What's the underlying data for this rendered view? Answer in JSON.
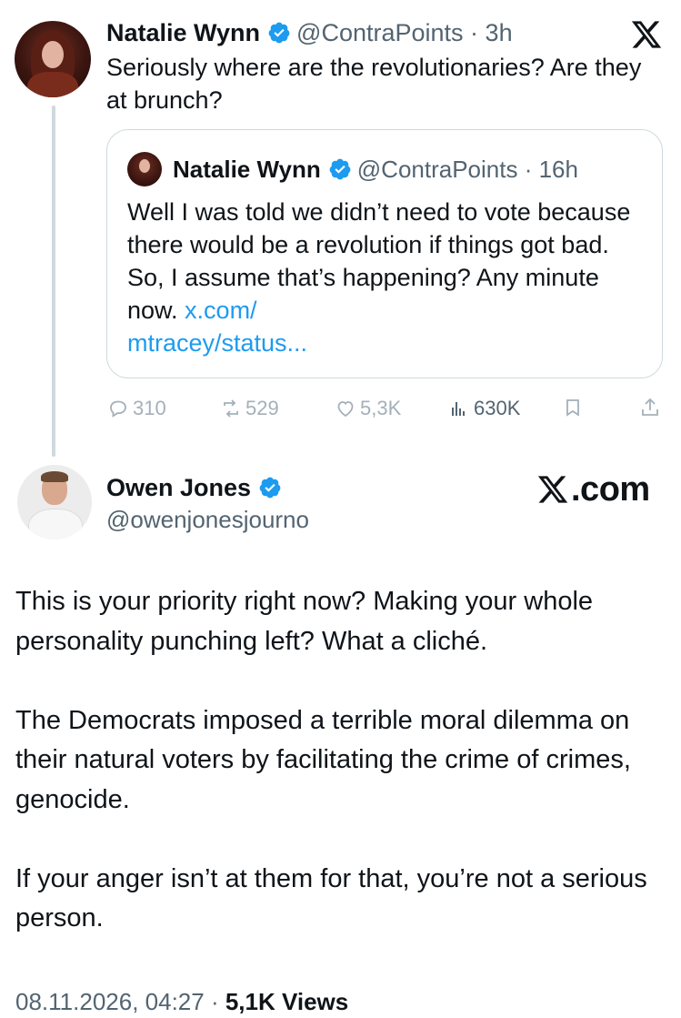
{
  "reply_tweet": {
    "author_name": "Natalie Wynn",
    "author_handle": "@ContraPoints",
    "time": "3h",
    "text": "Seriously where are the revolutionaries? Are they at brunch?",
    "quoted": {
      "author_name": "Natalie Wynn",
      "author_handle": "@ContraPoints",
      "time": "16h",
      "text": "Well I was told we didn’t need to vote because there would be a revolution if things got bad. So, I assume that’s happening? Any minute now. ",
      "link_text": "x.com/\nmtracey/status..."
    },
    "actions": {
      "replies": "310",
      "reposts": "529",
      "likes": "5,3K",
      "views": "630K"
    }
  },
  "main_tweet": {
    "author_name": "Owen Jones",
    "author_handle": "@owenjonesjourno",
    "brand": "X.com",
    "paragraphs": [
      "This is your priority right now? Making your whole personality punching left? What a cliché.",
      "The Democrats imposed a terrible moral dilemma on their natural voters by facilitating the crime of crimes, genocide.",
      "If your anger isn’t at them for that, you’re not a serious person."
    ],
    "footer_date": "08.11.2026, 04:27",
    "footer_views": "5,1K Views"
  },
  "colors": {
    "verified": "#1d9bf0",
    "link": "#1d9bf0",
    "secondary_text": "#536471",
    "divider": "#cfd9de"
  },
  "icons": [
    "x-logo-icon",
    "verified-badge-icon",
    "reply-icon",
    "repost-icon",
    "like-icon",
    "views-icon",
    "bookmark-icon",
    "share-icon"
  ]
}
